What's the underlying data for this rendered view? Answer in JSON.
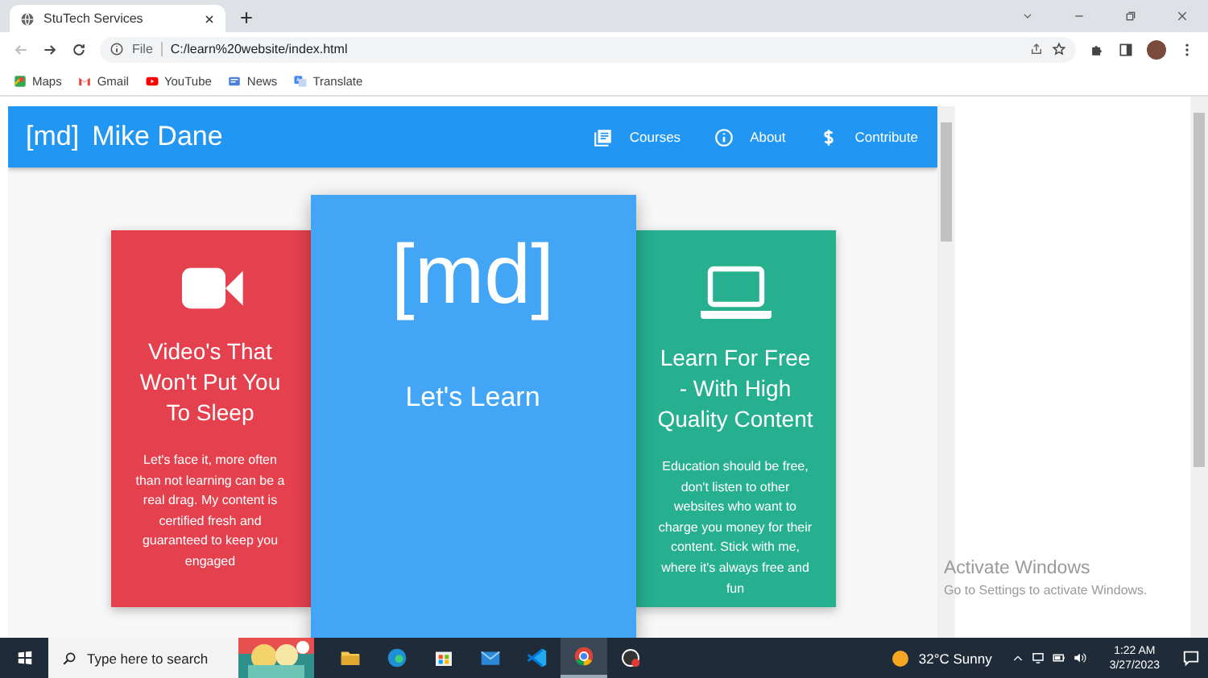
{
  "browser": {
    "tab": {
      "title": "StuTech Services"
    },
    "address": {
      "scheme": "File",
      "url": "C:/learn%20website/index.html"
    },
    "bookmarks": [
      {
        "label": "Maps",
        "kind": "maps"
      },
      {
        "label": "Gmail",
        "kind": "mail"
      },
      {
        "label": "YouTube",
        "kind": "video"
      },
      {
        "label": "News",
        "kind": "news"
      },
      {
        "label": "Translate",
        "kind": "translate"
      }
    ]
  },
  "site": {
    "brand_mark": "[md]",
    "brand_name": "Mike Dane",
    "nav": [
      {
        "label": "Courses",
        "kind": "book"
      },
      {
        "label": "About",
        "kind": "info"
      },
      {
        "label": "Contribute",
        "kind": "dollar"
      }
    ],
    "cards": [
      {
        "kind": "video",
        "color": "#e5404e",
        "title": "Video's That Won't Put You To Sleep",
        "text": "Let's face it, more often than not learning can be a real drag. My content is certified fresh and guaranteed to keep you engaged"
      },
      {
        "kind": "hero",
        "color": "#42a5f5",
        "mark": "[md]",
        "title": "Let's Learn"
      },
      {
        "kind": "laptop",
        "color": "#26b08f",
        "title": "Learn For Free - With High Quality Content",
        "text": "Education should be free, don't listen to other websites who want to charge you money for their content. Stick with me, where it's always free and fun"
      }
    ]
  },
  "watermark": {
    "title": "Activate Windows",
    "text": "Go to Settings to activate Windows."
  },
  "taskbar": {
    "search_placeholder": "Type here to search",
    "apps": [
      {
        "kind": "folder",
        "active": false
      },
      {
        "kind": "edge",
        "active": false
      },
      {
        "kind": "store",
        "active": false
      },
      {
        "kind": "mail",
        "active": false
      },
      {
        "kind": "code",
        "active": false
      },
      {
        "kind": "chrome",
        "active": true
      },
      {
        "kind": "recorder",
        "active": false
      }
    ],
    "weather": {
      "temp": "32°C",
      "condition": "Sunny"
    },
    "time": "1:22 AM",
    "date": "3/27/2023"
  }
}
